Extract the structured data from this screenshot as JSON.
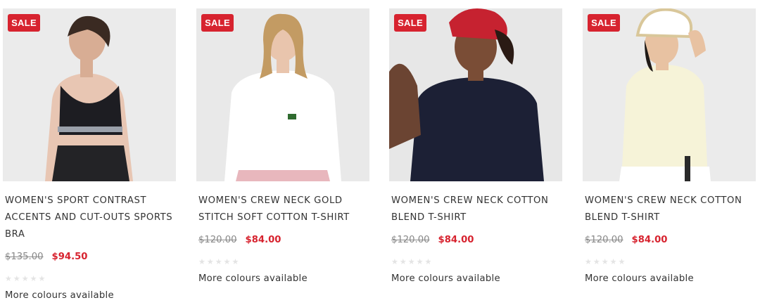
{
  "products": [
    {
      "badge": "SALE",
      "title": "WOMEN'S SPORT CONTRAST ACCENTS AND CUT-OUTS SPORTS BRA",
      "original_price": "$135.00",
      "sale_price": "$94.50",
      "rating": 0,
      "colours_text": "More colours available"
    },
    {
      "badge": "SALE",
      "title": "WOMEN'S CREW NECK GOLD STITCH SOFT COTTON T-SHIRT",
      "original_price": "$120.00",
      "sale_price": "$84.00",
      "rating": 0,
      "colours_text": "More colours available"
    },
    {
      "badge": "SALE",
      "title": "WOMEN'S CREW NECK COTTON BLEND T-SHIRT",
      "original_price": "$120.00",
      "sale_price": "$84.00",
      "rating": 0,
      "colours_text": "More colours available"
    },
    {
      "badge": "SALE",
      "title": "WOMEN'S CREW NECK COTTON BLEND T-SHIRT",
      "original_price": "$120.00",
      "sale_price": "$84.00",
      "rating": 0,
      "colours_text": "More colours available"
    }
  ],
  "colors": {
    "sale_red": "#d7232f",
    "text": "#333333",
    "strikethrough": "#888888",
    "star_empty": "#e4e4e4",
    "image_bg": "#ececec"
  }
}
